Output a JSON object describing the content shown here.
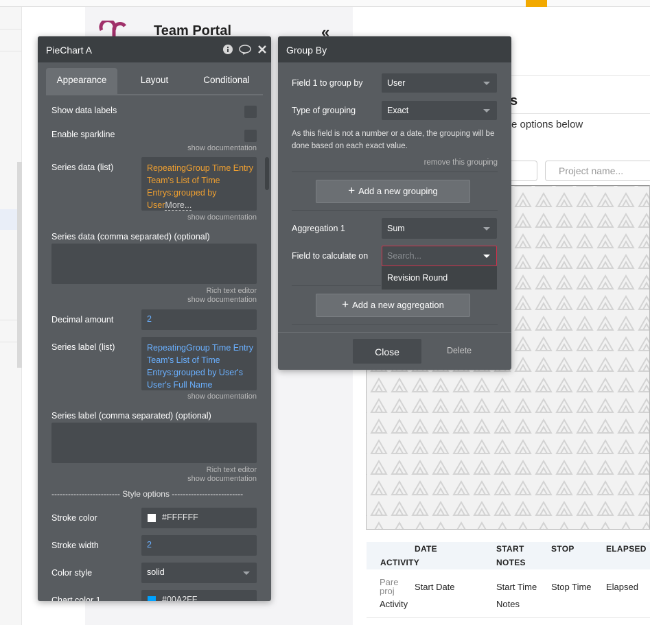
{
  "app": {
    "title": "Team Portal"
  },
  "background": {
    "heading_fragment": "s",
    "options_fragment": "e options below",
    "project_placeholder": "Project name...",
    "table": {
      "headers": [
        "DATE",
        "START",
        "STOP",
        "ELAPSED",
        "ACTIVITY",
        "NOTES"
      ],
      "row": {
        "image_alt": "Pare proj",
        "date": "Start Date",
        "start": "Start Time",
        "stop": "Stop Time",
        "elapsed": "Elapsed",
        "activity": "Activity",
        "notes": "Notes"
      }
    }
  },
  "piechart_panel": {
    "title": "PieChart A",
    "tabs": [
      "Appearance",
      "Layout",
      "Conditional"
    ],
    "active_tab": "Appearance",
    "show_data_labels": "Show data labels",
    "enable_sparkline": "Enable sparkline",
    "show_documentation": "show documentation",
    "rich_text_editor": "Rich text editor",
    "series_data_list_label": "Series data (list)",
    "series_data_list_value": [
      "RepeatingGroup Time Entry",
      "Team's List of Time",
      "Entrys:grouped by",
      "User"
    ],
    "series_data_more": "More...",
    "series_data_csv_label": "Series data (comma separated) (optional)",
    "decimal_amount_label": "Decimal amount",
    "decimal_amount_value": "2",
    "series_label_list_label": "Series label (list)",
    "series_label_list_value": [
      "RepeatingGroup Time Entry",
      "Team's List of Time",
      "Entrys:grouped by User's",
      "User's Full Name"
    ],
    "series_label_csv_label": "Series label (comma separated) (optional)",
    "style_options": "------------------------- Style options --------------------------",
    "stroke_color_label": "Stroke color",
    "stroke_color_value": "#FFFFFF",
    "stroke_width_label": "Stroke width",
    "stroke_width_value": "2",
    "color_style_label": "Color style",
    "color_style_value": "solid",
    "chart_color_1_label": "Chart color 1",
    "chart_color_1_value": "#00A2FF"
  },
  "groupby_panel": {
    "title": "Group By",
    "field1_label": "Field 1 to group by",
    "field1_value": "User",
    "type_label": "Type of grouping",
    "type_value": "Exact",
    "note": "As this field is not a number or a date, the grouping will be done based on each exact value.",
    "remove_grouping": "remove this grouping",
    "add_grouping": "Add a new grouping",
    "aggregation_label": "Aggregation 1",
    "aggregation_value": "Sum",
    "calc_field_label": "Field to calculate on",
    "calc_field_placeholder": "Search...",
    "calc_field_option": "Revision Round",
    "add_aggregation": "Add a new aggregation",
    "close": "Close",
    "delete": "Delete"
  },
  "colors": {
    "panel_bg": "#585c60",
    "panel_header": "#3b3f42",
    "field_bg": "#474b4f",
    "link_orange": "#f0a030",
    "link_blue": "#6ab0ff",
    "chart_color_1": "#00A2FF",
    "accent": "#f2a900",
    "logo": "#a0306a"
  }
}
